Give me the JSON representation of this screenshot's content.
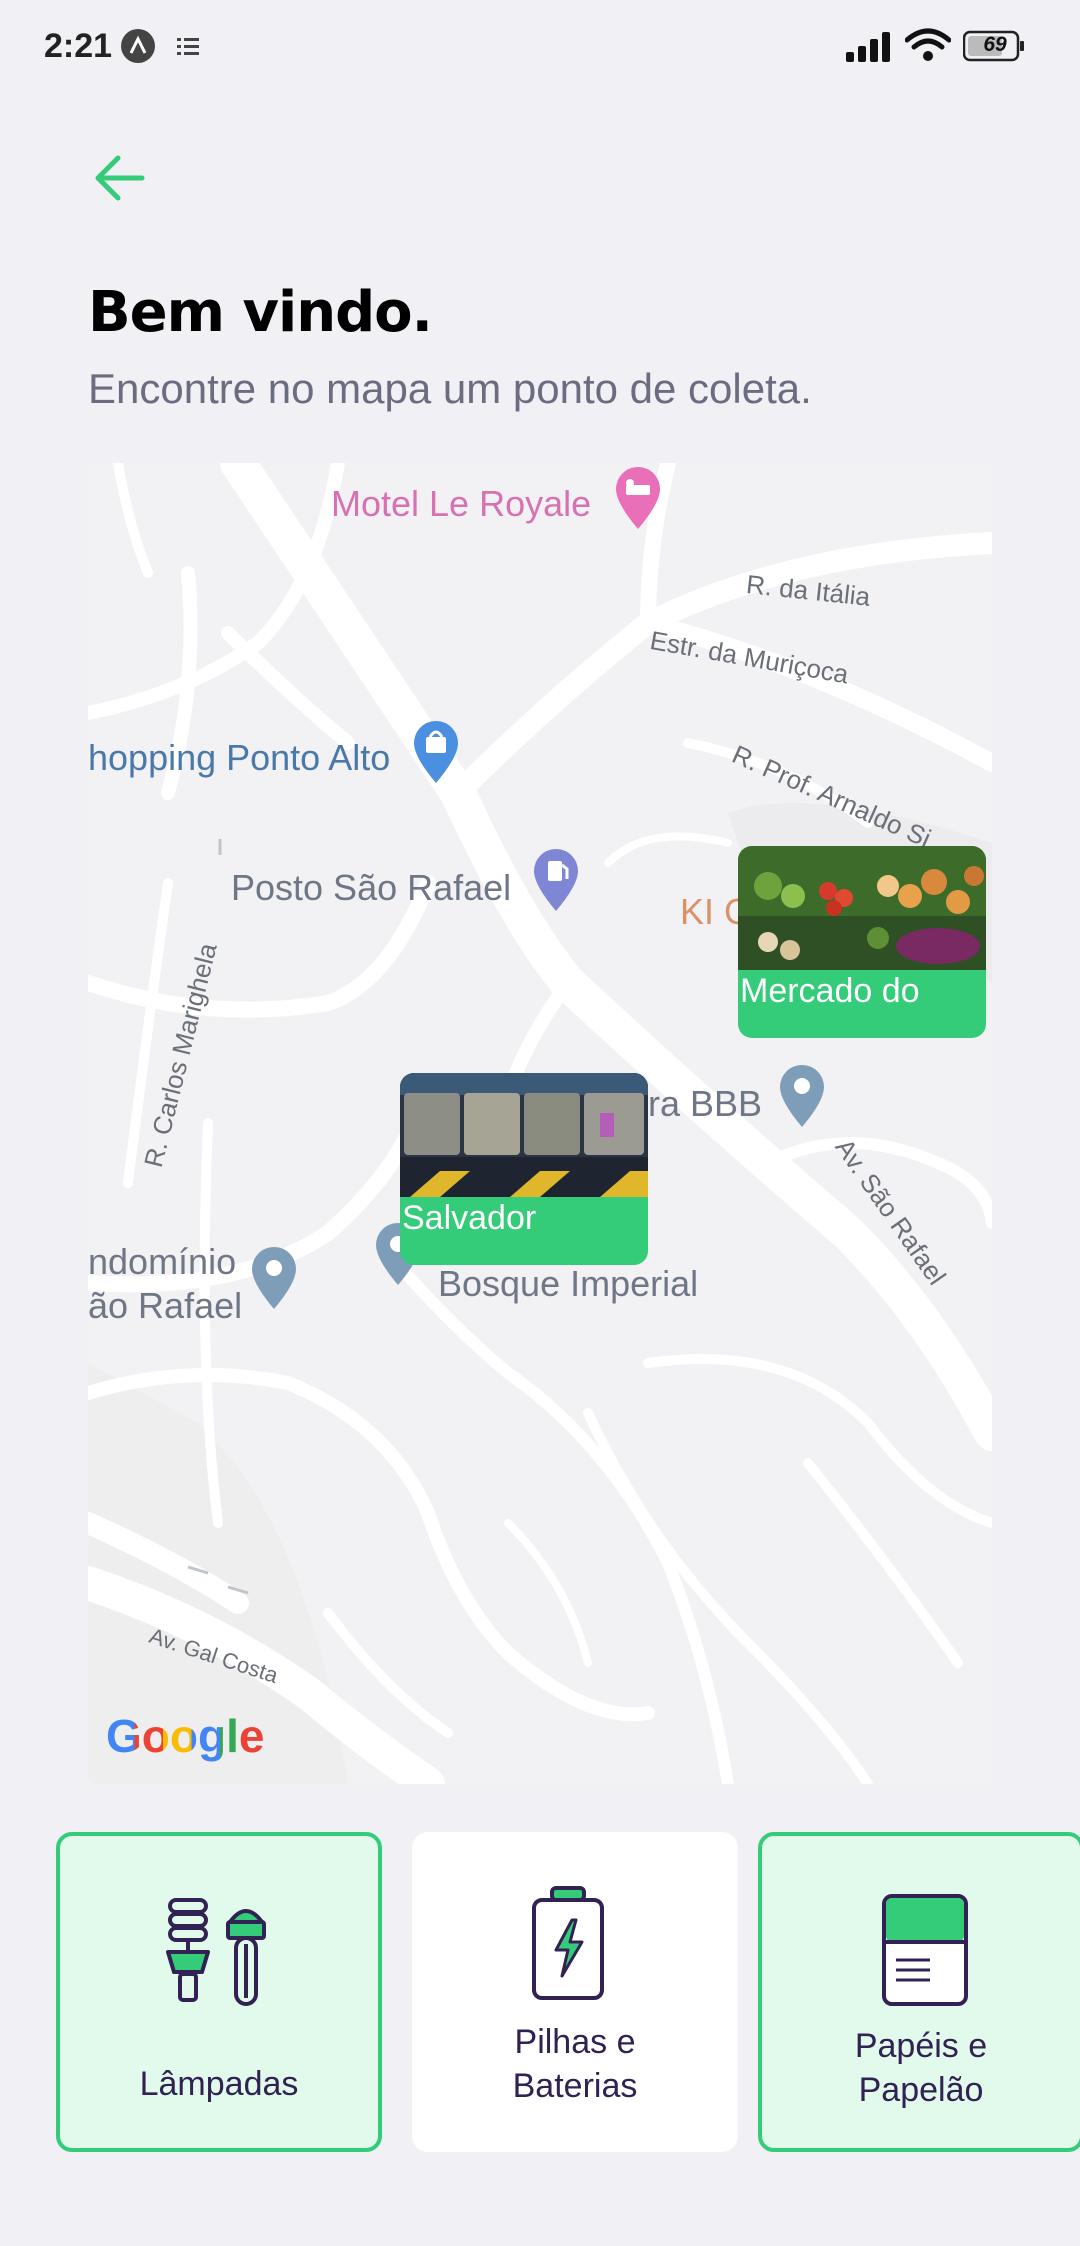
{
  "status_bar": {
    "time": "2:21",
    "battery": "69",
    "icons": [
      "app-notification-icon",
      "list-icon",
      "signal-icon",
      "wifi-icon",
      "battery-icon"
    ]
  },
  "header": {
    "back_icon": "arrow-left-icon",
    "title": "Bem vindo.",
    "subtitle": "Encontre no mapa um ponto de coleta."
  },
  "map": {
    "places": [
      {
        "name": "Motel Le Royale",
        "icon": "hotel-pin-icon"
      },
      {
        "name": "hopping Ponto Alto",
        "icon": "shopping-pin-icon"
      },
      {
        "name": "Posto São Rafael",
        "icon": "gas-station-pin-icon"
      },
      {
        "name": "KI G",
        "icon": ""
      },
      {
        "name": "ra BBB",
        "icon": "place-pin-icon"
      },
      {
        "name": "ndomínio",
        "icon": "place-pin-icon"
      },
      {
        "name": "ão Rafael",
        "icon": ""
      },
      {
        "name": "Bosque Imperial",
        "icon": "place-pin-icon"
      }
    ],
    "streets": [
      "R. da Itália",
      "Estr. da Muriçoca",
      "R. Prof. Arnaldo Si",
      "R. Carlos Marighela",
      "Av. São Rafael",
      "Av. Gal Costa"
    ],
    "markers": [
      {
        "label": "Mercado do",
        "image": "vegetables-photo"
      },
      {
        "label": "Salvador",
        "image": "recycling-bins-photo"
      }
    ],
    "attribution": "Google"
  },
  "items": [
    {
      "label_line1": "Lâmpadas",
      "label_line2": "",
      "icon": "lamps-icon",
      "selected": true
    },
    {
      "label_line1": "Pilhas e",
      "label_line2": "Baterias",
      "icon": "battery-icon",
      "selected": false
    },
    {
      "label_line1": "Papéis e",
      "label_line2": "Papelão",
      "icon": "paper-icon",
      "selected": true
    }
  ],
  "colors": {
    "accent": "#34cb79",
    "selected_bg": "#e1faec",
    "background": "#f0f0f5",
    "title": "#000000",
    "text": "#322153",
    "subtitle": "#6c6c80"
  }
}
